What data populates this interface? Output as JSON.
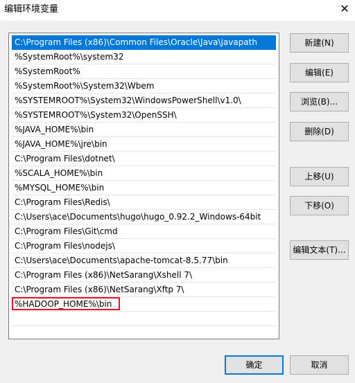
{
  "window": {
    "title": "编辑环境变量",
    "close_glyph": "✕"
  },
  "paths": [
    "C:\\Program Files (x86)\\Common Files\\Oracle\\Java\\javapath",
    "%SystemRoot%\\system32",
    "%SystemRoot%",
    "%SystemRoot%\\System32\\Wbem",
    "%SYSTEMROOT%\\System32\\WindowsPowerShell\\v1.0\\",
    "%SYSTEMROOT%\\System32\\OpenSSH\\",
    "%JAVA_HOME%\\bin",
    "%JAVA_HOME%\\jre\\bin",
    "C:\\Program Files\\dotnet\\",
    "%SCALA_HOME%\\bin",
    "%MYSQL_HOME%\\bin",
    "C:\\Program Files\\Redis\\",
    "C:\\Users\\ace\\Documents\\hugo\\hugo_0.92.2_Windows-64bit",
    "C:\\Program Files\\Git\\cmd",
    "C:\\Program Files\\nodejs\\",
    "C:\\Users\\ace\\Documents\\apache-tomcat-8.5.77\\bin",
    "C:\\Program Files (x86)\\NetSarang\\Xshell 7\\",
    "C:\\Program Files (x86)\\NetSarang\\Xftp 7\\",
    "%HADOOP_HOME%\\bin"
  ],
  "buttons": {
    "new": "新建(N)",
    "edit": "编辑(E)",
    "browse": "浏览(B)...",
    "delete": "删除(D)",
    "move_up": "上移(U)",
    "move_down": "下移(O)",
    "edit_text": "编辑文本(T)...",
    "ok": "确定",
    "cancel": "取消"
  },
  "colors": {
    "selection": "#0078d7",
    "highlight_box": "#e81123"
  }
}
